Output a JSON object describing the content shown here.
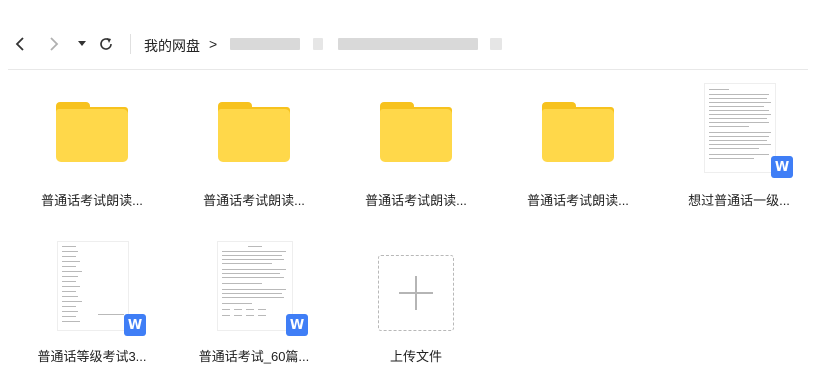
{
  "nav": {
    "back_icon": "chevron-left-icon",
    "forward_icon": "chevron-right-icon",
    "history_icon": "caret-down-icon",
    "refresh_icon": "refresh-icon"
  },
  "breadcrumb": {
    "root": "我的网盘",
    "separator": ">"
  },
  "items": [
    {
      "type": "folder",
      "label": "普通话考试朗读..."
    },
    {
      "type": "folder",
      "label": "普通话考试朗读..."
    },
    {
      "type": "folder",
      "label": "普通话考试朗读..."
    },
    {
      "type": "folder",
      "label": "普通话考试朗读..."
    },
    {
      "type": "doc",
      "label": "想过普通话一级...",
      "badge": "W"
    },
    {
      "type": "doc",
      "label": "普通话等级考试3...",
      "badge": "W"
    },
    {
      "type": "doc",
      "label": "普通话考试_60篇...",
      "badge": "W"
    },
    {
      "type": "upload",
      "label": "上传文件"
    }
  ],
  "colors": {
    "folder": "#ffd84a",
    "folder_tab": "#f7c21e",
    "word_badge": "#3f7ef6"
  }
}
